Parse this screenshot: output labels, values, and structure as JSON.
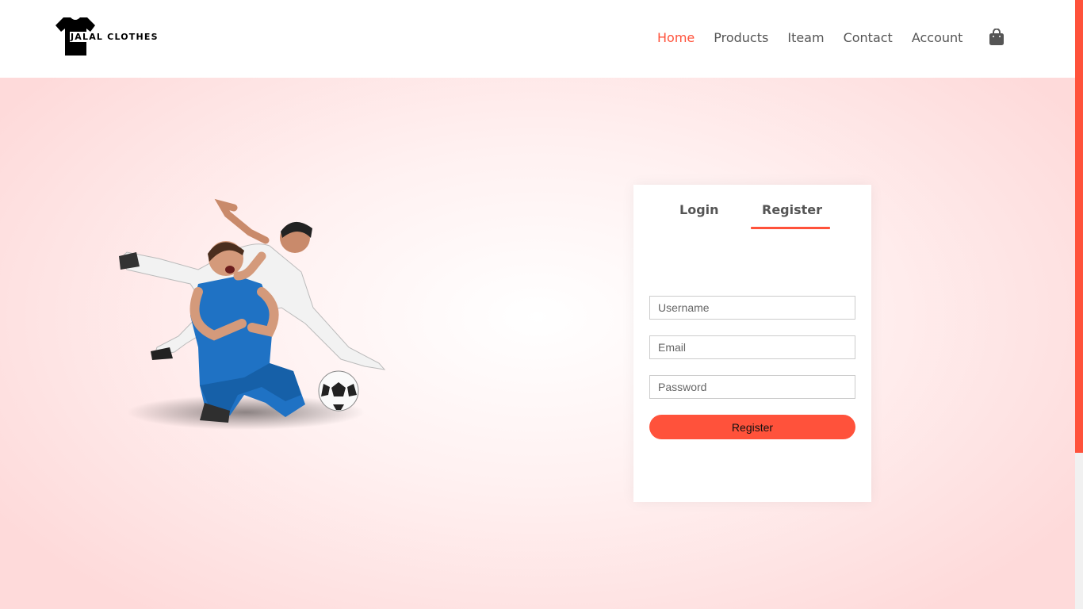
{
  "brand": {
    "name": "JALAL CLOTHES",
    "accent": "#ff523b"
  },
  "nav": {
    "items": [
      {
        "label": "Home",
        "active": true
      },
      {
        "label": "Products",
        "active": false
      },
      {
        "label": "Iteam",
        "active": false
      },
      {
        "label": "Contact",
        "active": false
      },
      {
        "label": "Account",
        "active": false
      }
    ],
    "cart_icon": "shopping-bag-icon"
  },
  "hero": {
    "image": "football-players-illustration"
  },
  "form": {
    "tabs": {
      "login": "Login",
      "register": "Register",
      "active": "register"
    },
    "username_placeholder": "Username",
    "email_placeholder": "Email",
    "password_placeholder": "Password",
    "submit_label": "Register"
  }
}
